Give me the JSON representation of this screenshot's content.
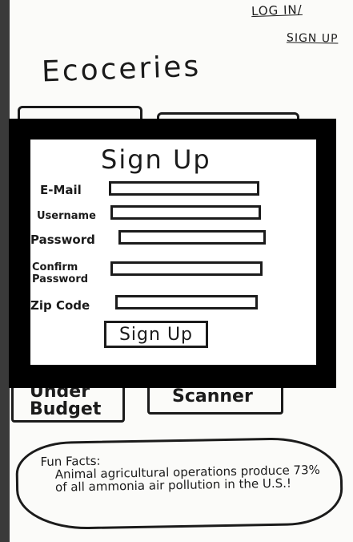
{
  "header": {
    "login_label": "LOG IN/",
    "signup_label": "SIGN UP",
    "brand": "Ecoceries"
  },
  "tiles": {
    "under_budget": "Under Budget",
    "scanner": "Scanner"
  },
  "fun_facts": {
    "heading": "Fun Facts:",
    "text": "Animal agricultural operations produce 73% of all ammonia air pollution in the U.S.!"
  },
  "modal": {
    "title": "Sign Up",
    "fields": {
      "email": "E-Mail",
      "username": "Username",
      "password": "Password",
      "confirm_line1": "Confirm",
      "confirm_line2": "Password",
      "zip": "Zip Code"
    },
    "submit_label": "Sign Up"
  },
  "colors": {
    "ink": "#1b1b1b",
    "paper": "#fbfbf9",
    "modal_border": "#000000",
    "outer": "#3a3a3a"
  }
}
